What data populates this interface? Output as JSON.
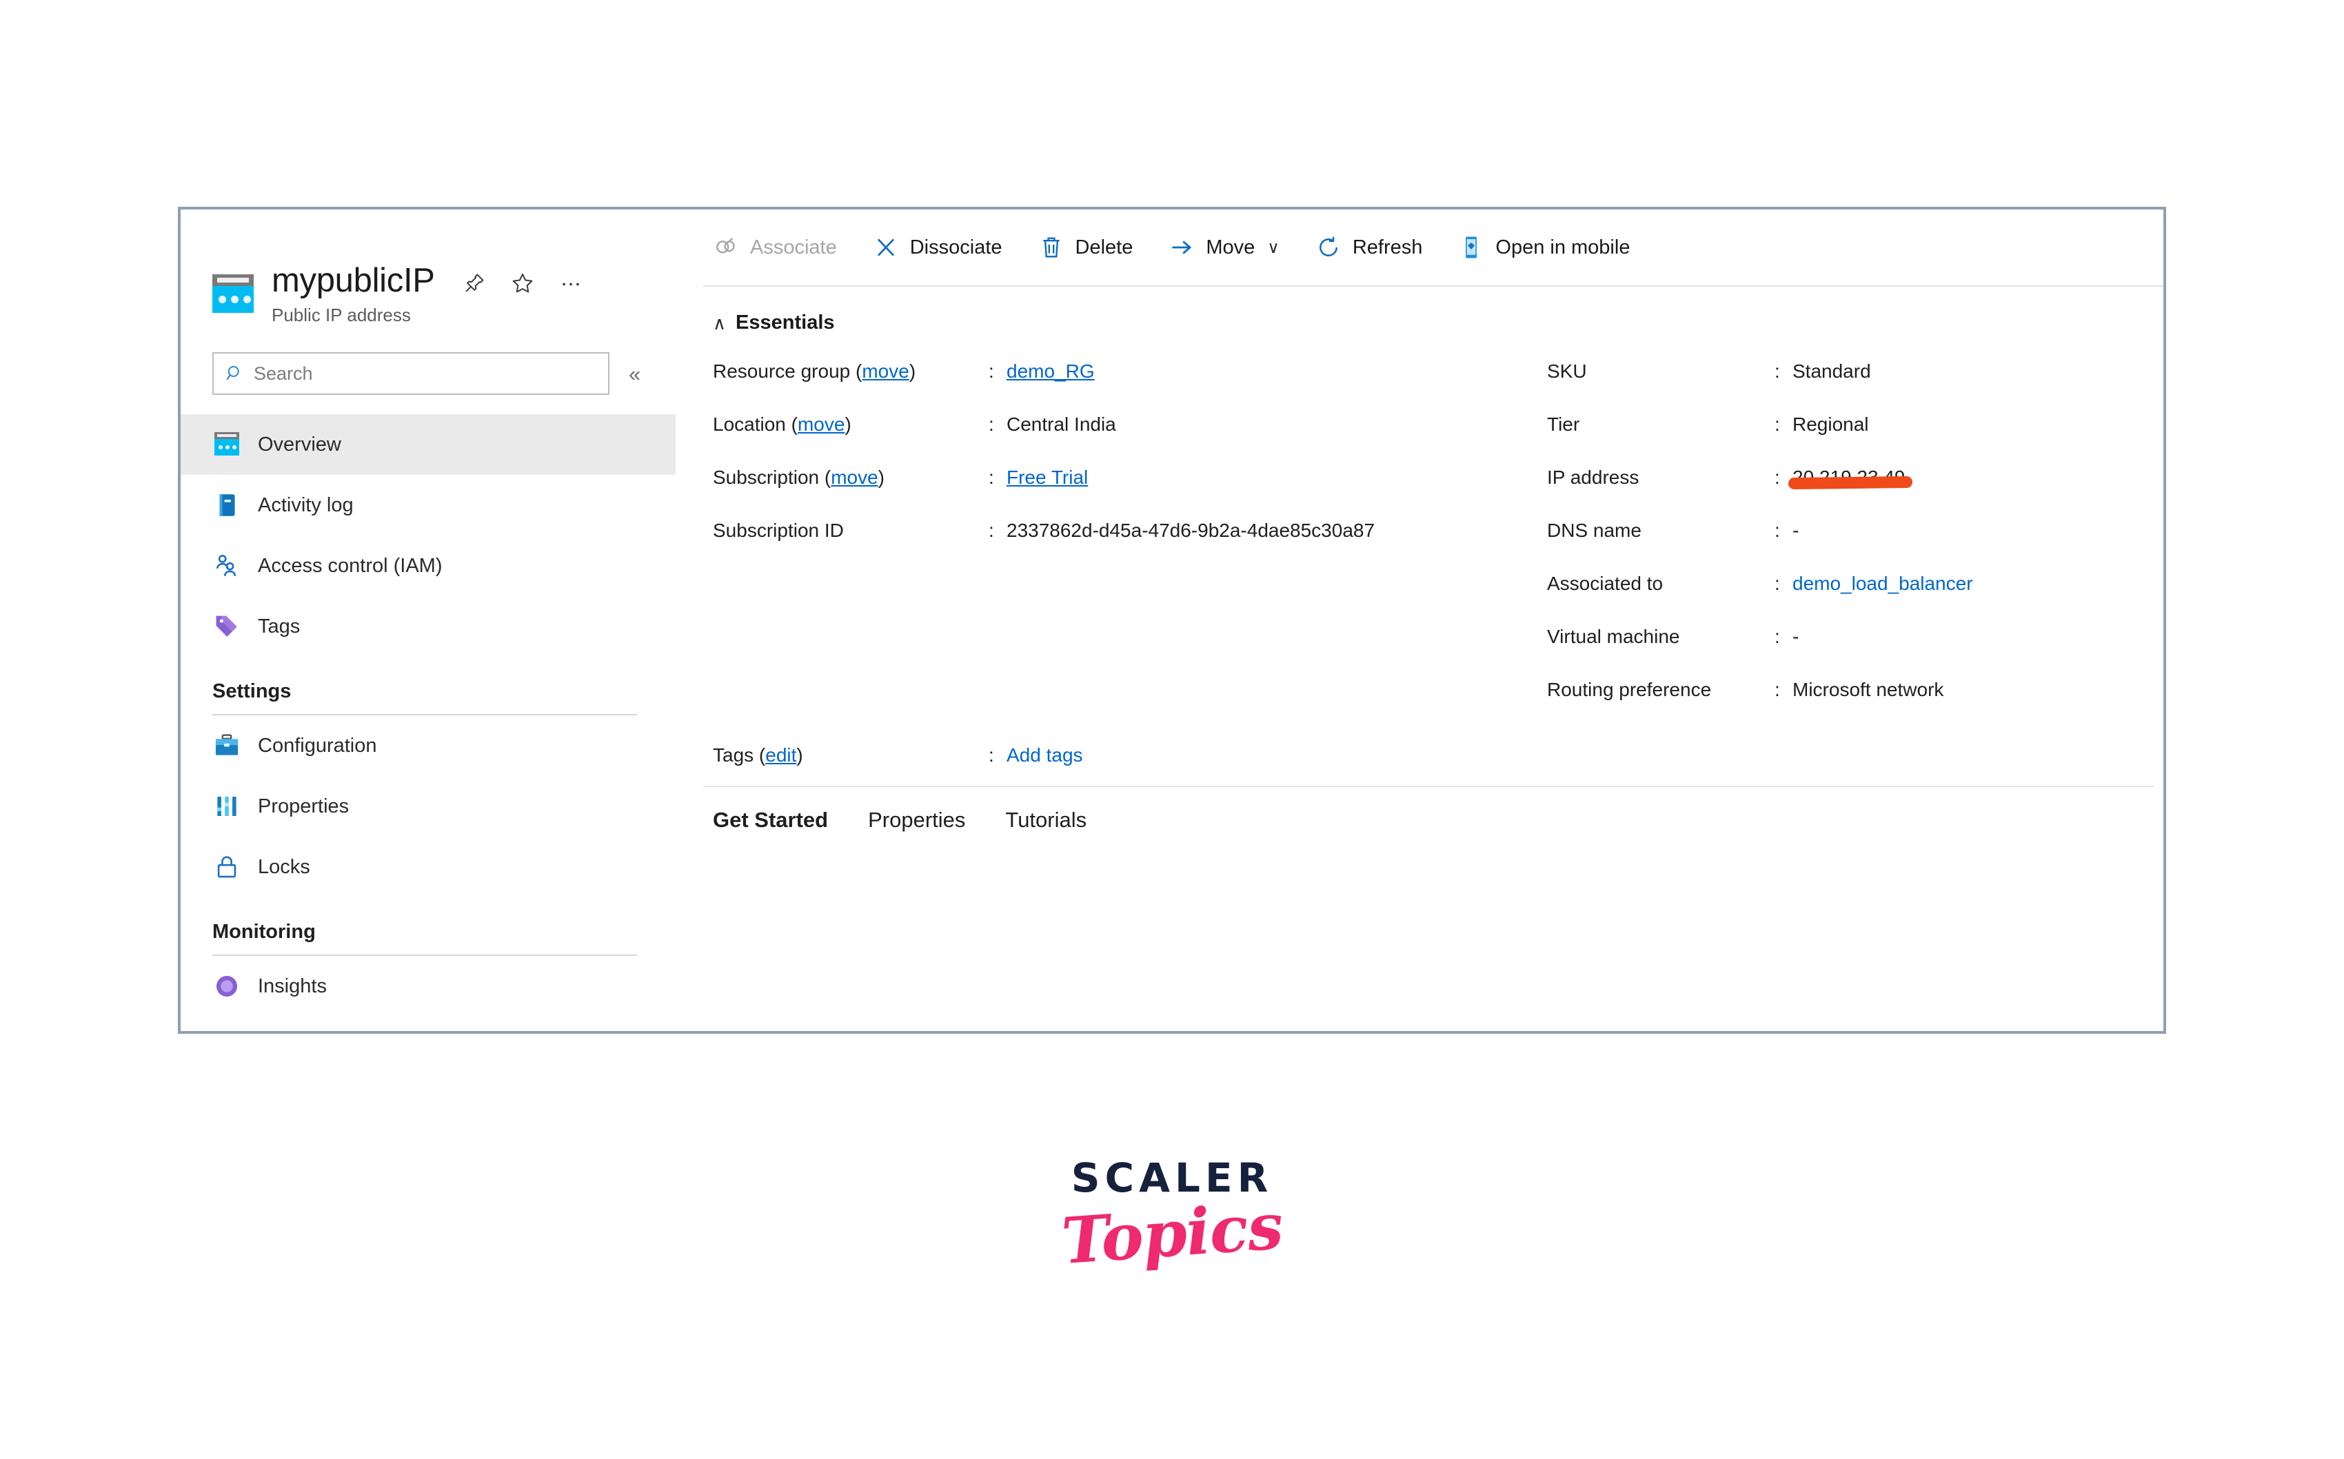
{
  "resource": {
    "name": "mypublicIP",
    "type_label": "Public IP address",
    "icon": "public-ip-icon",
    "title_actions": [
      {
        "name": "pin-icon",
        "label": "Pin to dashboard"
      },
      {
        "name": "favorite-star-icon",
        "label": "Add to favorites"
      },
      {
        "name": "more-ellipsis-icon",
        "label": "More"
      }
    ]
  },
  "search": {
    "placeholder": "Search",
    "icon": "search-icon",
    "collapse_icon": "chevron-double-left-icon",
    "collapse_label": "«"
  },
  "sidebar": {
    "items": [
      {
        "label": "Overview",
        "icon": "overview-icon",
        "selected": true
      },
      {
        "label": "Activity log",
        "icon": "activity-log-icon",
        "selected": false
      },
      {
        "label": "Access control (IAM)",
        "icon": "access-control-icon",
        "selected": false
      },
      {
        "label": "Tags",
        "icon": "tags-icon",
        "selected": false
      }
    ],
    "groups": [
      {
        "title": "Settings",
        "items": [
          {
            "label": "Configuration",
            "icon": "configuration-icon"
          },
          {
            "label": "Properties",
            "icon": "properties-icon"
          },
          {
            "label": "Locks",
            "icon": "lock-icon"
          }
        ]
      },
      {
        "title": "Monitoring",
        "items": [
          {
            "label": "Insights",
            "icon": "insights-icon"
          }
        ]
      }
    ]
  },
  "toolbar": {
    "commands": [
      {
        "label": "Associate",
        "icon": "associate-link-icon",
        "disabled": true,
        "caret": false
      },
      {
        "label": "Dissociate",
        "icon": "dissociate-x-icon",
        "disabled": false,
        "caret": false
      },
      {
        "label": "Delete",
        "icon": "trash-delete-icon",
        "disabled": false,
        "caret": false
      },
      {
        "label": "Move",
        "icon": "move-arrow-icon",
        "disabled": false,
        "caret": true
      },
      {
        "label": "Refresh",
        "icon": "refresh-icon",
        "disabled": false,
        "caret": false
      },
      {
        "label": "Open in mobile",
        "icon": "mobile-phone-icon",
        "disabled": false,
        "caret": false
      }
    ],
    "move_caret": "∨"
  },
  "essentials": {
    "title": "Essentials",
    "collapse_chevron": "∧",
    "left_rows": [
      {
        "key": "Resource group",
        "key_link": "move",
        "value": "demo_RG",
        "value_is_link": true,
        "value_underline": true
      },
      {
        "key": "Location",
        "key_link": "move",
        "value": "Central India",
        "value_is_link": false,
        "value_underline": false
      },
      {
        "key": "Subscription",
        "key_link": "move",
        "value": "Free Trial",
        "value_is_link": true,
        "value_underline": true
      },
      {
        "key": "Subscription ID",
        "key_link": null,
        "value": "2337862d-d45a-47d6-9b2a-4dae85c30a87",
        "value_is_link": false,
        "value_underline": false
      }
    ],
    "right_rows": [
      {
        "key": "SKU",
        "value": "Standard",
        "value_is_link": false,
        "redacted": false
      },
      {
        "key": "Tier",
        "value": "Regional",
        "value_is_link": false,
        "redacted": false
      },
      {
        "key": "IP address",
        "value": "20.219.23.49",
        "value_is_link": false,
        "redacted": true
      },
      {
        "key": "DNS name",
        "value": "-",
        "value_is_link": false,
        "redacted": false
      },
      {
        "key": "Associated to",
        "value": "demo_load_balancer",
        "value_is_link": true,
        "redacted": false
      },
      {
        "key": "Virtual machine",
        "value": "-",
        "value_is_link": false,
        "redacted": false
      },
      {
        "key": "Routing preference",
        "value": "Microsoft network",
        "value_is_link": false,
        "redacted": false
      }
    ],
    "tags_row": {
      "key": "Tags",
      "key_link": "edit",
      "value": "Add tags"
    },
    "colon": ":"
  },
  "content_tabs": [
    {
      "label": "Get Started",
      "active": true
    },
    {
      "label": "Properties",
      "active": false
    },
    {
      "label": "Tutorials",
      "active": false
    }
  ],
  "watermark": {
    "primary": "SCALER",
    "secondary": "Topics",
    "primary_color": "#16213e",
    "secondary_color": "#ef2a6e"
  },
  "colors": {
    "accent_link": "#0066cc",
    "azure_cyan": "#00bcf2",
    "azure_blue": "#0078d4",
    "redaction": "#f04a1a",
    "selected_row": "#eaeaea",
    "frame_border": "#8f9fb5"
  }
}
